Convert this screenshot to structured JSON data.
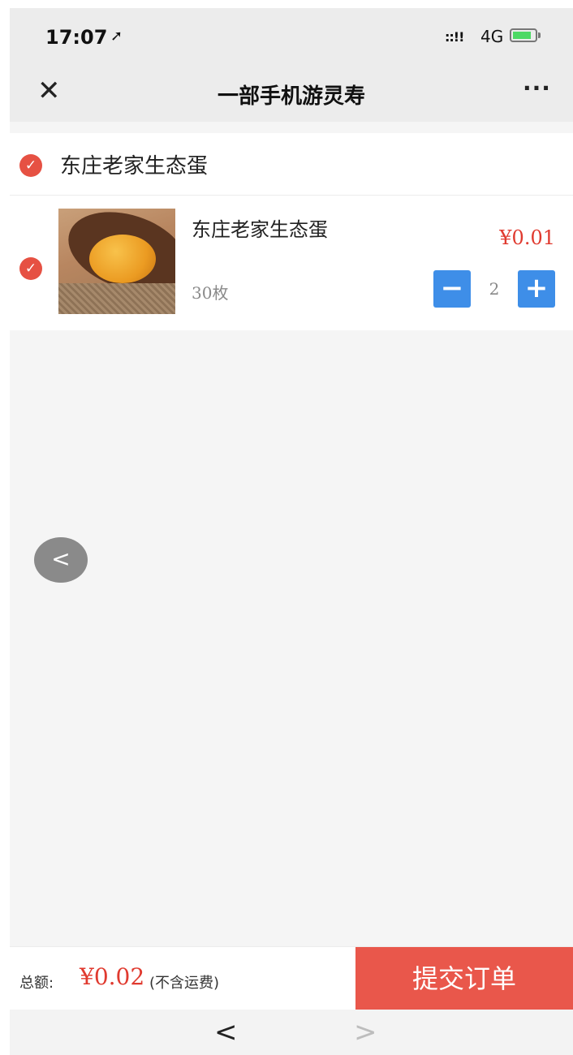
{
  "status_bar": {
    "time": "17:07",
    "location_icon": "location-arrow-icon",
    "signal_icon": "signal-icon",
    "network": "4G",
    "battery_icon": "battery-charging-icon"
  },
  "nav": {
    "close_icon": "close-icon",
    "title": "一部手机游灵寿",
    "more_icon": "more-icon"
  },
  "store": {
    "name": "东庄老家生态蛋",
    "checked": true
  },
  "product": {
    "name": "东庄老家生态蛋",
    "price": "¥0.01",
    "spec": "30枚",
    "quantity": "2",
    "checked": true,
    "image_icon": "egg-yolk-on-spoon-image"
  },
  "stepper": {
    "minus": "−",
    "plus": "+"
  },
  "footer": {
    "total_label": "总额:",
    "total_value": "¥0.02",
    "shipping_note": "(不含运费)",
    "submit_label": "提交订单"
  },
  "browser_nav": {
    "back": "<",
    "forward": ">"
  },
  "colors": {
    "accent_red": "#e65143",
    "price_red": "#e03a2f",
    "stepper_blue": "#3e8ee8",
    "submit_bg": "#e9574b"
  }
}
